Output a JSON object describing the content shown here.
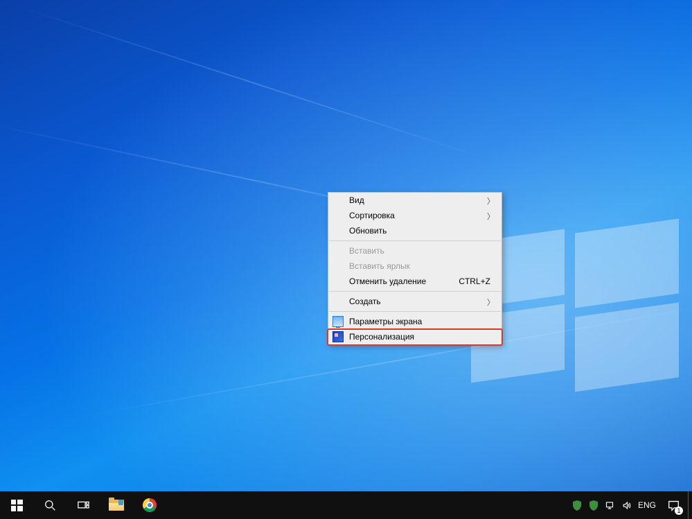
{
  "context_menu": {
    "items": [
      {
        "label": "Вид",
        "has_submenu": true,
        "enabled": true
      },
      {
        "label": "Сортировка",
        "has_submenu": true,
        "enabled": true
      },
      {
        "label": "Обновить",
        "enabled": true
      },
      {
        "separator": true
      },
      {
        "label": "Вставить",
        "enabled": false
      },
      {
        "label": "Вставить ярлык",
        "enabled": false
      },
      {
        "label": "Отменить удаление",
        "shortcut": "CTRL+Z",
        "enabled": true
      },
      {
        "separator": true
      },
      {
        "label": "Создать",
        "has_submenu": true,
        "enabled": true
      },
      {
        "separator": true
      },
      {
        "label": "Параметры экрана",
        "icon": "display-icon",
        "enabled": true
      },
      {
        "label": "Персонализация",
        "icon": "personalize-icon",
        "enabled": true,
        "highlighted": true
      }
    ]
  },
  "taskbar": {
    "left_items": [
      {
        "name": "start-button",
        "kind": "start"
      },
      {
        "name": "search-button",
        "kind": "search"
      },
      {
        "name": "task-view-button",
        "kind": "taskview"
      },
      {
        "name": "file-explorer-button",
        "kind": "folder"
      },
      {
        "name": "chrome-button",
        "kind": "chrome"
      }
    ],
    "tray": {
      "icons": [
        "security-shield-icon-1",
        "security-shield-icon-2",
        "network-icon",
        "volume-icon"
      ],
      "language": "ENG",
      "notification_count": "1"
    }
  }
}
